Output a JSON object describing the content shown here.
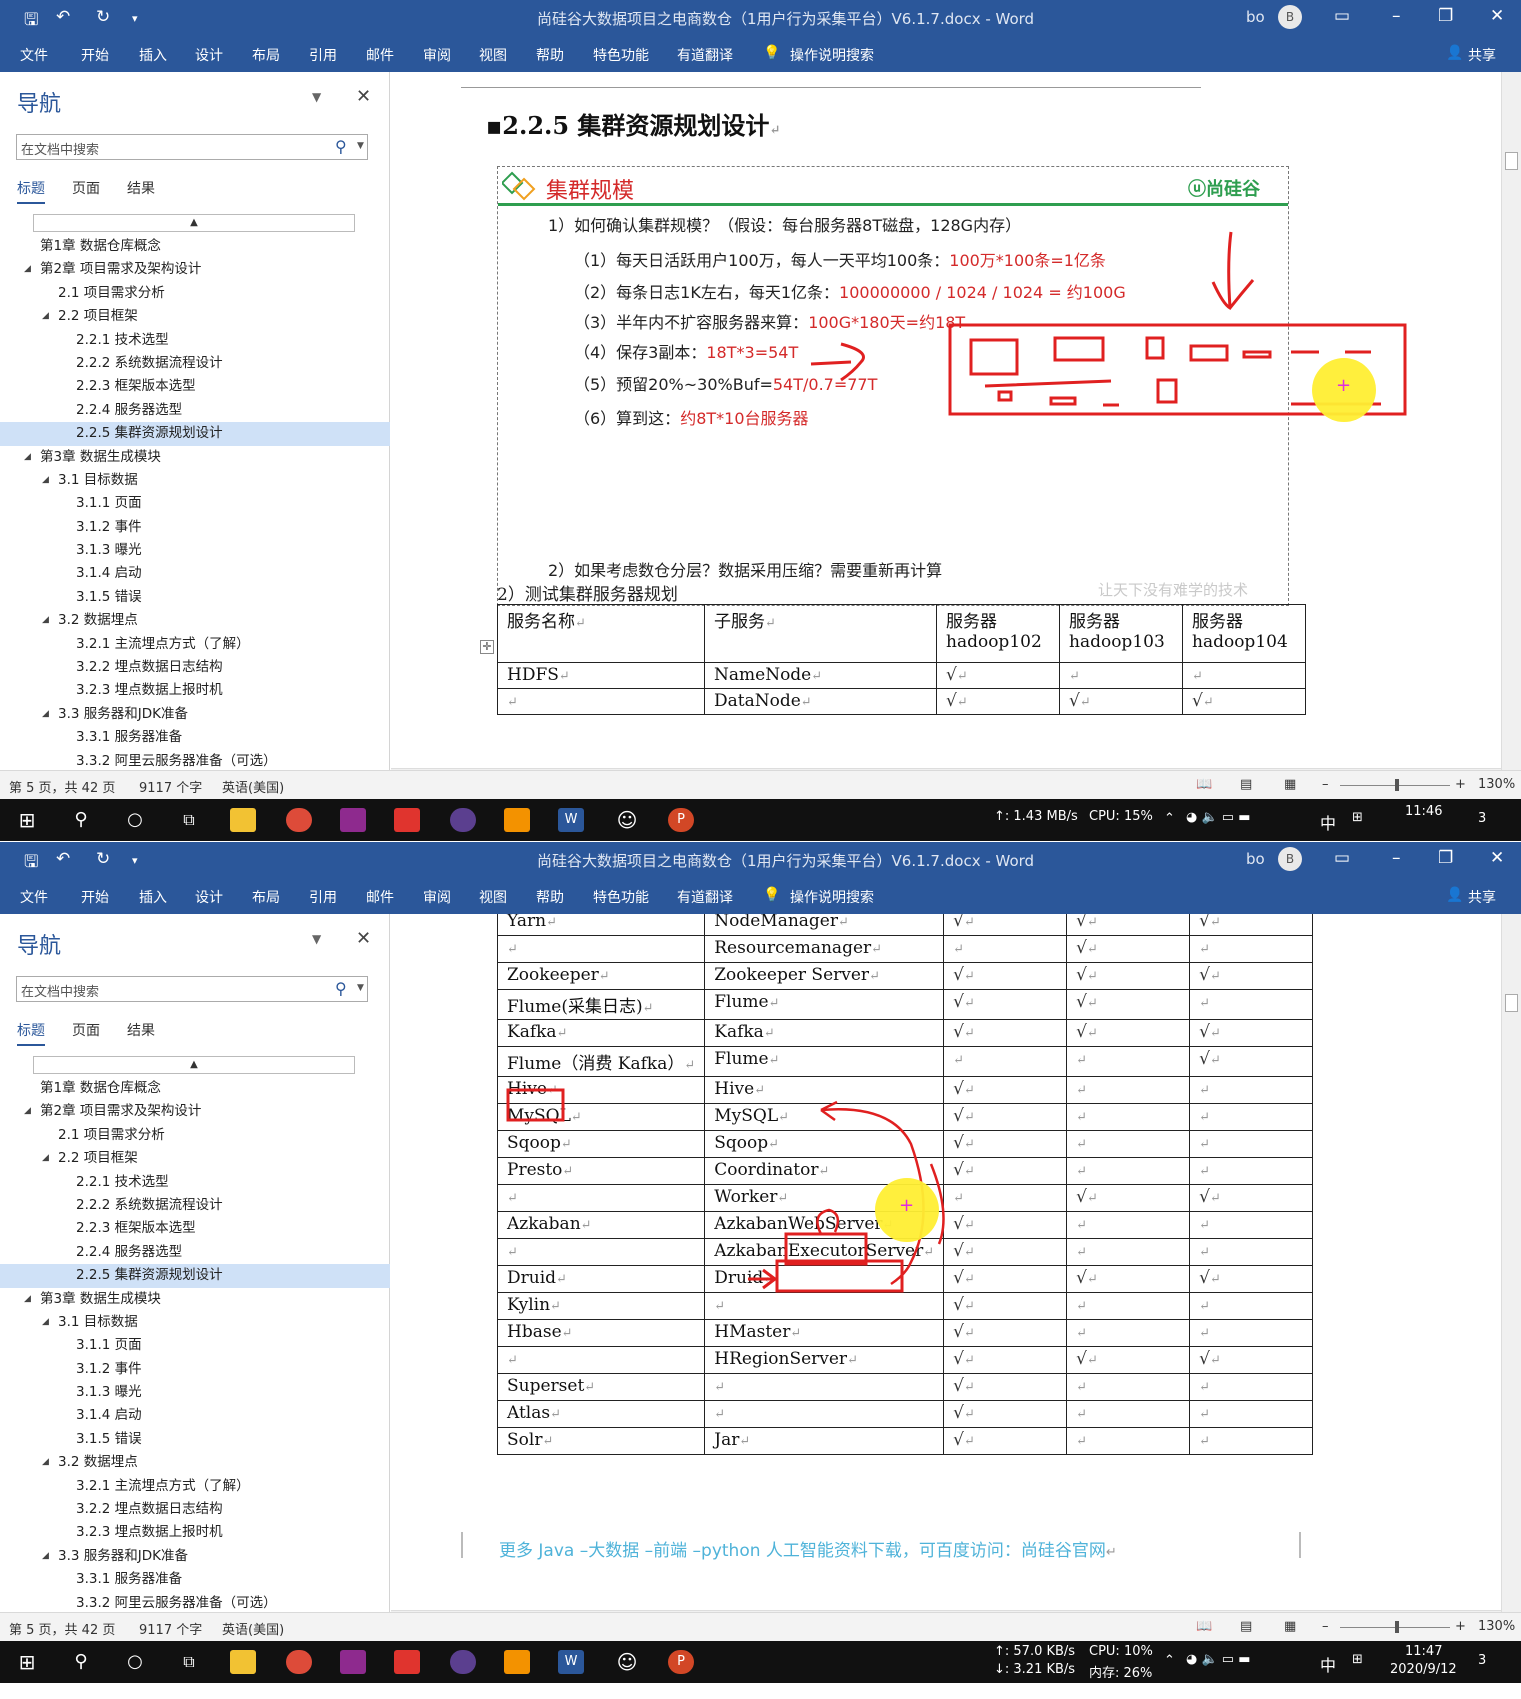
{
  "window": {
    "title": "尚硅谷大数据项目之电商数仓（1用户行为采集平台）V6.1.7.docx  -  Word",
    "user": "bo",
    "avatar_letter": "B",
    "accent": "#2b579a"
  },
  "ribbon": {
    "tabs": [
      "文件",
      "开始",
      "插入",
      "设计",
      "布局",
      "引用",
      "邮件",
      "审阅",
      "视图",
      "帮助",
      "特色功能",
      "有道翻译"
    ],
    "tell_me": "操作说明搜索",
    "share": "共享"
  },
  "nav": {
    "title": "导航",
    "search_placeholder": "在文档中搜索",
    "tabs": [
      "标题",
      "页面",
      "结果"
    ],
    "items": [
      {
        "label": "第1章 数据仓库概念",
        "level": 1,
        "expanded": false
      },
      {
        "label": "第2章 项目需求及架构设计",
        "level": 1,
        "expanded": true
      },
      {
        "label": "2.1 项目需求分析",
        "level": 2,
        "expanded": false
      },
      {
        "label": "2.2 项目框架",
        "level": 2,
        "expanded": true
      },
      {
        "label": "2.2.1 技术选型",
        "level": 3,
        "expanded": false
      },
      {
        "label": "2.2.2 系统数据流程设计",
        "level": 3,
        "expanded": false
      },
      {
        "label": "2.2.3 框架版本选型",
        "level": 3,
        "expanded": false
      },
      {
        "label": "2.2.4 服务器选型",
        "level": 3,
        "expanded": false
      },
      {
        "label": "2.2.5 集群资源规划设计",
        "level": 3,
        "expanded": false,
        "selected": true
      },
      {
        "label": "第3章 数据生成模块",
        "level": 1,
        "expanded": true
      },
      {
        "label": "3.1 目标数据",
        "level": 2,
        "expanded": true
      },
      {
        "label": "3.1.1 页面",
        "level": 3,
        "expanded": false
      },
      {
        "label": "3.1.2 事件",
        "level": 3,
        "expanded": false
      },
      {
        "label": "3.1.3 曝光",
        "level": 3,
        "expanded": false
      },
      {
        "label": "3.1.4 启动",
        "level": 3,
        "expanded": false
      },
      {
        "label": "3.1.5 错误",
        "level": 3,
        "expanded": false
      },
      {
        "label": "3.2 数据埋点",
        "level": 2,
        "expanded": true
      },
      {
        "label": "3.2.1 主流埋点方式（了解）",
        "level": 3,
        "expanded": false
      },
      {
        "label": "3.2.2 埋点数据日志结构",
        "level": 3,
        "expanded": false
      },
      {
        "label": "3.2.3 埋点数据上报时机",
        "level": 3,
        "expanded": false
      },
      {
        "label": "3.3 服务器和JDK准备",
        "level": 2,
        "expanded": true
      },
      {
        "label": "3.3.1 服务器准备",
        "level": 3,
        "expanded": false
      },
      {
        "label": "3.3.2 阿里云服务器准备（可选）",
        "level": 3,
        "expanded": false
      }
    ]
  },
  "status": {
    "page": "第 5 页，共 42 页",
    "words": "9117 个字",
    "lang": "英语(美国)",
    "zoom": "130%"
  },
  "doc1": {
    "heading": "2.2.5  集群资源规划设计",
    "box_title": "集群规模",
    "logo": "尚硅谷",
    "q1": "1）如何确认集群规模？（假设：每台服务器8T磁盘，128G内存）",
    "lines": [
      {
        "text": "（1）每天日活跃用户100万，每人一天平均100条：",
        "red": "100万*100条=1亿条"
      },
      {
        "text": "（2）每条日志1K左右，每天1亿条：",
        "red": "100000000 / 1024 / 1024 = 约100G"
      },
      {
        "text": "（3）半年内不扩容服务器来算：",
        "red": "100G*180天=约18T"
      },
      {
        "text": "（4）保存3副本：",
        "red": "18T*3=54T"
      },
      {
        "text": "（5）预留20%~30%Buf=",
        "red": "54T/0.7=77T"
      },
      {
        "text": "（6）算到这：",
        "red": "约8T*10台服务器"
      }
    ],
    "q2": "2）如果考虑数仓分层？数据采用压缩？需要重新再计算",
    "watermark": "让天下没有难学的技术",
    "subtitle": "2）测试集群服务器规划",
    "table_header": [
      "服务名称",
      "子服务",
      "服务器\nhadoop102",
      "服务器\nhadoop103",
      "服务器\nhadoop104"
    ],
    "rows": [
      [
        "HDFS",
        "NameNode",
        "√",
        "",
        ""
      ],
      [
        "",
        "DataNode",
        "√",
        "√",
        "√"
      ]
    ]
  },
  "doc2": {
    "rows": [
      [
        "Yarn",
        "NodeManager",
        "√",
        "√",
        "√"
      ],
      [
        "",
        "Resourcemanager",
        "",
        "√",
        ""
      ],
      [
        "Zookeeper",
        "Zookeeper Server",
        "√",
        "√",
        "√"
      ],
      [
        "Flume(采集日志)",
        "Flume",
        "√",
        "√",
        ""
      ],
      [
        "Kafka",
        "Kafka",
        "√",
        "√",
        "√"
      ],
      [
        "Flume（消费 Kafka）",
        "Flume",
        "",
        "",
        "√"
      ],
      [
        "Hive",
        "Hive",
        "√",
        "",
        ""
      ],
      [
        "MySQL",
        "MySQL",
        "√",
        "",
        ""
      ],
      [
        "Sqoop",
        "Sqoop",
        "√",
        "",
        ""
      ],
      [
        "Presto",
        "Coordinator",
        "√",
        "",
        ""
      ],
      [
        "",
        "Worker",
        "",
        "√",
        "√"
      ],
      [
        "Azkaban",
        "AzkabanWebServer",
        "√",
        "",
        ""
      ],
      [
        "",
        "AzkabanExecutorServer",
        "√",
        "",
        ""
      ],
      [
        "Druid",
        "Druid",
        "√",
        "√",
        "√"
      ],
      [
        "Kylin",
        "",
        "√",
        "",
        ""
      ],
      [
        "Hbase",
        "HMaster",
        "√",
        "",
        ""
      ],
      [
        "",
        "HRegionServer",
        "√",
        "√",
        "√"
      ],
      [
        "Superset",
        "",
        "√",
        "",
        ""
      ],
      [
        "Atlas",
        "",
        "√",
        "",
        ""
      ],
      [
        "Solr",
        "Jar",
        "√",
        "",
        ""
      ]
    ],
    "footnote": "更多 Java –大数据 –前端 –python 人工智能资料下载，可百度访问：尚硅谷官网"
  },
  "taskbar1": {
    "net_up": "↑: 1.43 MB/s",
    "cpu": "CPU: 15%",
    "ime": "中",
    "time": "11:46",
    "notif": "3"
  },
  "taskbar2": {
    "net_up": "↑: 57.0 KB/s",
    "net_down": "↓: 3.21 KB/s",
    "cpu": "CPU: 10%",
    "mem": "内存: 26%",
    "ime": "中",
    "time": "11:47",
    "date": "2020/9/12",
    "notif": "3"
  },
  "icons": {
    "save": "save-icon",
    "undo": "undo-icon",
    "redo": "redo-icon",
    "bulb": "lightbulb-icon",
    "search": "search-icon",
    "windows": "windows-start-icon"
  }
}
